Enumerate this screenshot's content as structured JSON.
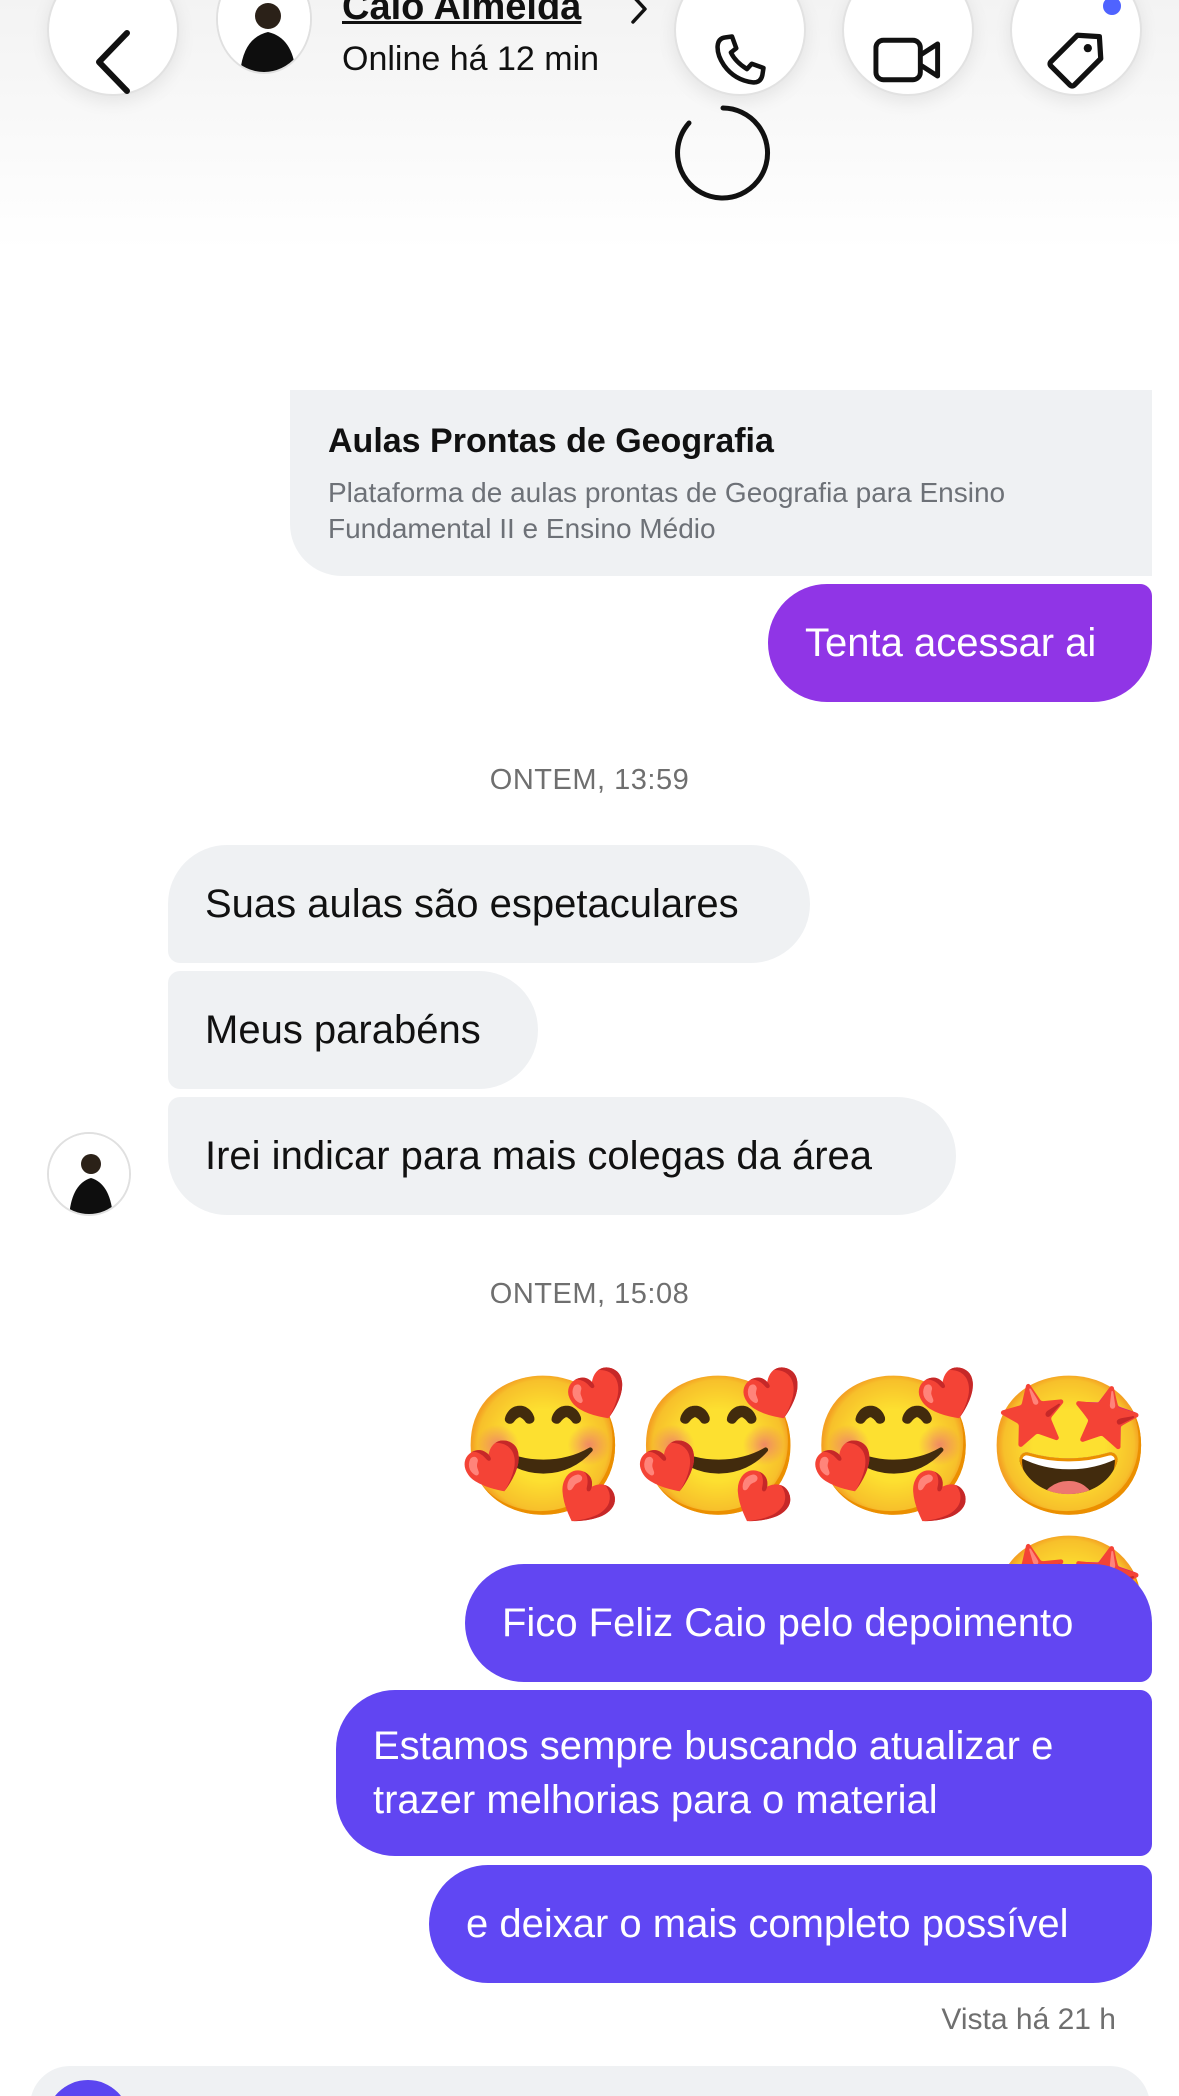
{
  "header": {
    "contact_name": "Caio Almeida",
    "status": "Online há 12 min",
    "icons": {
      "back": "chevron-left-icon",
      "call": "phone-icon",
      "video": "video-camera-icon",
      "tag": "tag-icon",
      "refresh": "loading-spinner-icon"
    },
    "tag_badge_color": "#4f63ff"
  },
  "link_preview": {
    "title": "Aulas Prontas de Geografia",
    "description": "Plataforma de aulas prontas de Geografia para Ensino Fundamental II e Ensino Médio"
  },
  "messages_group1": {
    "outgoing": "Tenta acessar ai"
  },
  "timestamp1": "ONTEM, 13:59",
  "incoming": [
    {
      "text": "Suas aulas são espetaculares"
    },
    {
      "text": "Meus parabéns"
    },
    {
      "text": "Irei indicar para mais colegas da área"
    }
  ],
  "timestamp2": "ONTEM, 15:08",
  "emoji_message": "🥰🥰🥰🤩🤩",
  "outgoing": [
    {
      "text": "Fico Feliz Caio pelo depoimento"
    },
    {
      "line1": "Estamos sempre buscando atualizar e",
      "line2": "trazer melhorias para o material"
    },
    {
      "text": "e deixar o mais completo possível"
    }
  ],
  "seen_status": "Vista há 21 h",
  "colors": {
    "outgoing_purple": "#9035e6",
    "outgoing_indigo": "#6145f2",
    "incoming_bg": "#eff1f3"
  }
}
